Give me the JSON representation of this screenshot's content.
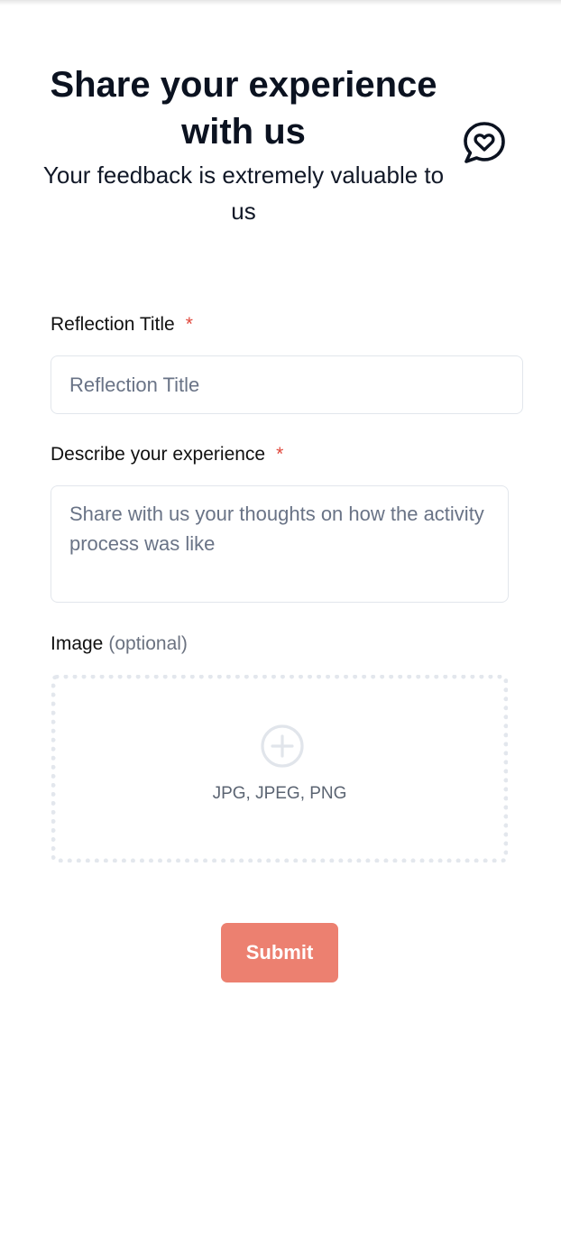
{
  "header": {
    "title": "Share your experience with us",
    "subtitle": "Your feedback is extremely valuable to us",
    "icon": "chat-heart-icon"
  },
  "form": {
    "reflection_title": {
      "label": "Reflection Title",
      "required_marker": "*",
      "placeholder": "Reflection Title",
      "value": ""
    },
    "description": {
      "label": "Describe your experience",
      "required_marker": "*",
      "placeholder": "Share with us your thoughts on how the activity process was like",
      "value": ""
    },
    "image": {
      "label": "Image",
      "optional_note": "(optional)",
      "upload_icon": "plus-circle-icon",
      "accepted_formats": "JPG, JPEG, PNG"
    },
    "submit_label": "Submit"
  },
  "colors": {
    "accent": "#ec8070",
    "required": "#e0483c",
    "heading": "#0b1220",
    "muted": "#6b7280",
    "border": "#e2e6ec"
  }
}
